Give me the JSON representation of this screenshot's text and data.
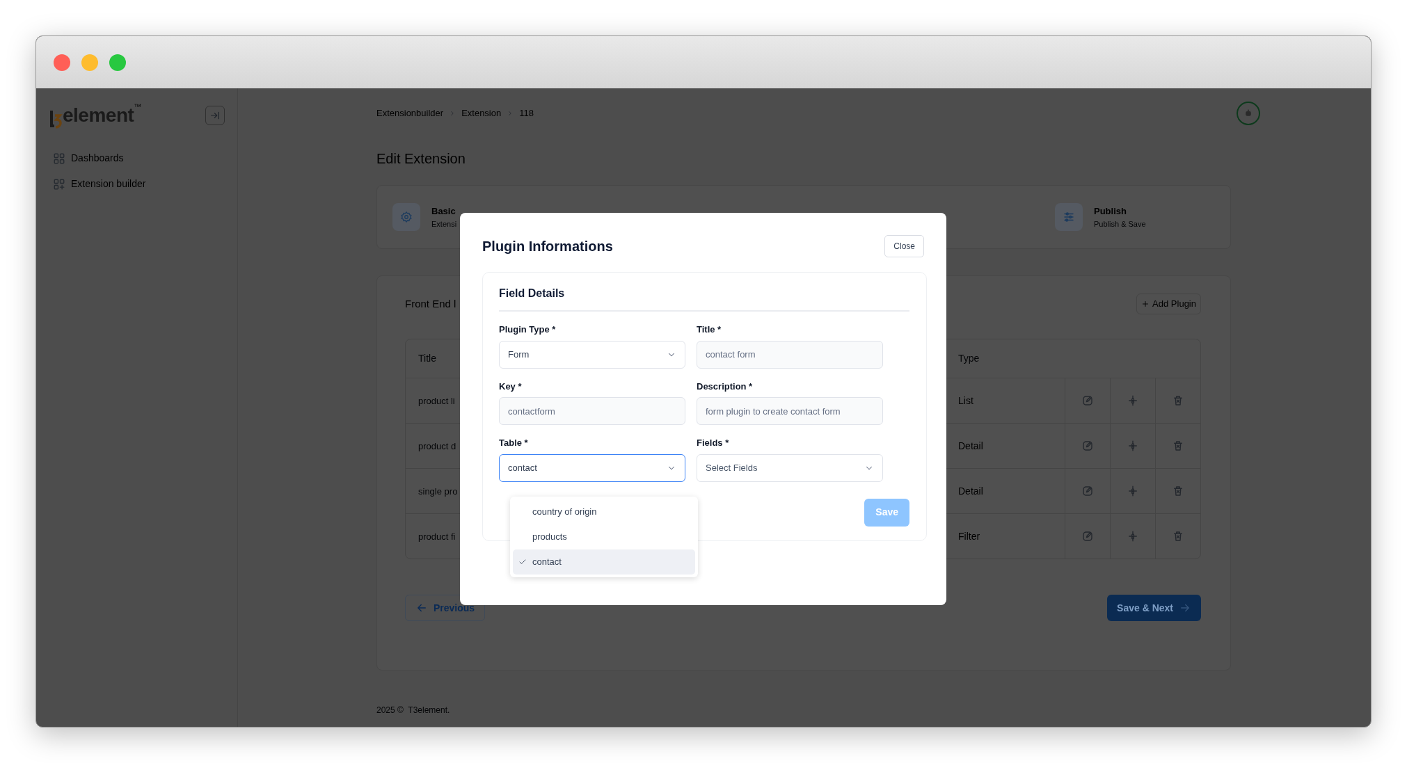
{
  "window": {
    "controls": [
      {
        "color": "#ff5f57"
      },
      {
        "color": "#febc2e"
      },
      {
        "color": "#28c840"
      }
    ]
  },
  "sidebar": {
    "logo": "element",
    "logo_mark": "™",
    "items": [
      {
        "label": "Dashboards",
        "kind": "grid"
      },
      {
        "label": "Extension builder",
        "kind": "grid-plus"
      }
    ]
  },
  "breadcrumb": [
    "Extensionbuilder",
    "Extension",
    "118"
  ],
  "page_title": "Edit Extension",
  "steps": [
    {
      "title": "Basic",
      "subtitle": "Extensi",
      "kind": "gear"
    },
    {
      "title": "Publish",
      "subtitle": "Publish & Save",
      "kind": "sliders"
    }
  ],
  "plugins": {
    "title": "Front End l",
    "add_button": "Add Plugin",
    "columns": [
      "Title",
      "Type"
    ],
    "rows": [
      {
        "title": "product li",
        "type": "List"
      },
      {
        "title": "product d",
        "type": "Detail"
      },
      {
        "title": "single pro",
        "type": "Detail"
      },
      {
        "title": "product fi",
        "type": "Filter"
      }
    ]
  },
  "previous_button": "Previous",
  "next_button": "Save & Next",
  "footer": "2025 ©  T3element.",
  "modal": {
    "title": "Plugin Informations",
    "close_button": "Close",
    "section": "Field Details",
    "fields": [
      {
        "label": "Plugin Type *",
        "kind": "select",
        "value": "Form",
        "focused": false
      },
      {
        "label": "Title *",
        "kind": "text",
        "value": "contact form",
        "disabled": true
      },
      {
        "label": "Key *",
        "kind": "text",
        "value": "contactform",
        "disabled": true
      },
      {
        "label": "Description *",
        "kind": "text",
        "value": "form plugin to create contact form",
        "disabled": true
      },
      {
        "label": "Table *",
        "kind": "select",
        "value": "contact",
        "focused": true
      },
      {
        "label": "Fields *",
        "kind": "select",
        "placeholder": "Select Fields",
        "focused": false
      }
    ],
    "dropdown": [
      {
        "label": "country of origin",
        "selected": false
      },
      {
        "label": "products",
        "selected": false
      },
      {
        "label": "contact",
        "selected": true
      }
    ],
    "save_button": "Save",
    "save_disabled": true
  }
}
